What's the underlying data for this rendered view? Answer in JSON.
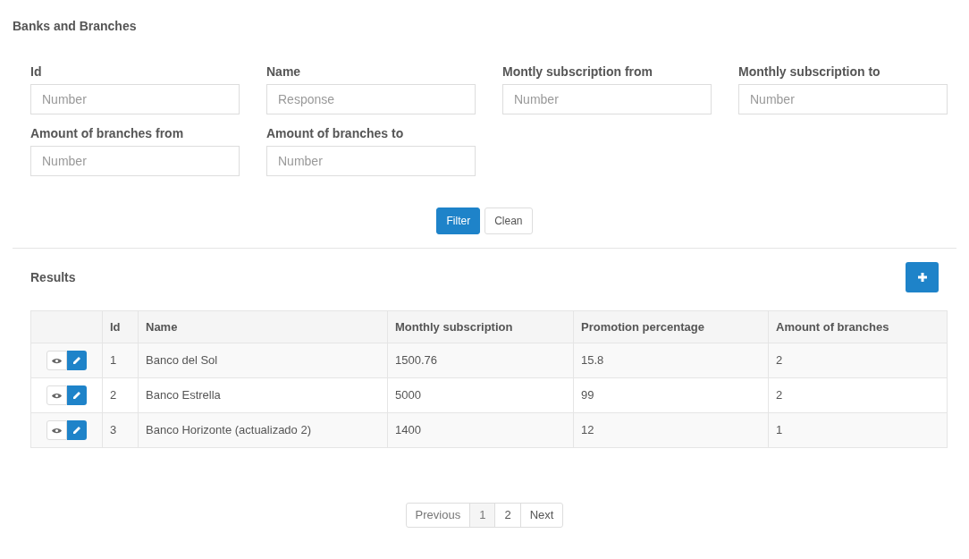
{
  "title": "Banks and Branches",
  "filters": [
    {
      "label": "Id",
      "placeholder": "Number"
    },
    {
      "label": "Name",
      "placeholder": "Response"
    },
    {
      "label": "Montly subscription from",
      "placeholder": "Number"
    },
    {
      "label": "Monthly subscription to",
      "placeholder": "Number"
    },
    {
      "label": "Amount of branches from",
      "placeholder": "Number"
    },
    {
      "label": "Amount of branches to",
      "placeholder": "Number"
    }
  ],
  "buttons": [
    {
      "label": "Filter",
      "kind": "primary"
    },
    {
      "label": "Clean",
      "kind": "default"
    }
  ],
  "results": {
    "title": "Results",
    "columns": [
      "Id",
      "Name",
      "Monthly subscription",
      "Promotion percentage",
      "Amount of branches"
    ],
    "rows": [
      [
        "1",
        "Banco del Sol",
        "1500.76",
        "15.8",
        "2"
      ],
      [
        "2",
        "Banco Estrella",
        "5000",
        "99",
        "2"
      ],
      [
        "3",
        "Banco Horizonte (actualizado 2)",
        "1400",
        "12",
        "1"
      ]
    ]
  },
  "pagination": {
    "previous": "Previous",
    "next": "Next",
    "pages": [
      {
        "label": "1",
        "selected": true
      },
      {
        "label": "2",
        "selected": false
      }
    ]
  }
}
